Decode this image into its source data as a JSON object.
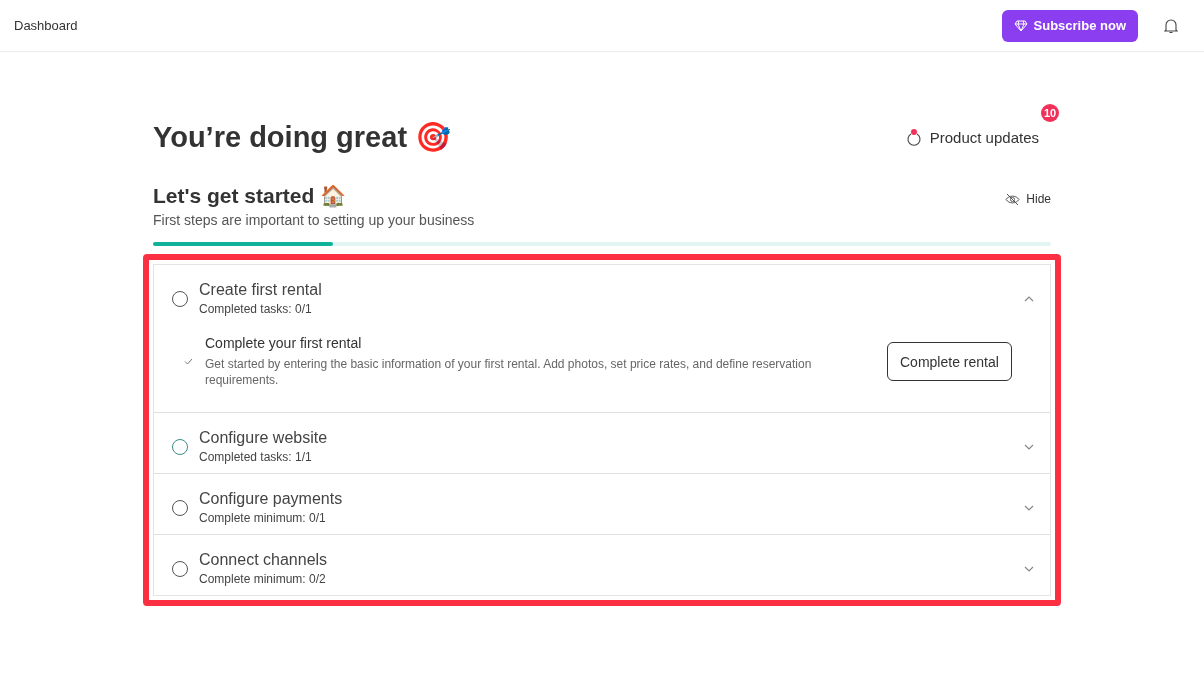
{
  "header": {
    "title": "Dashboard",
    "subscribe_button": "Subscribe now"
  },
  "heading": "You’re doing great 🎯",
  "product_updates": {
    "label": "Product updates",
    "badge": "10"
  },
  "section": {
    "title": "Let's get started 🏠",
    "subtitle": "First steps are important to setting up your business",
    "hide_label": "Hide",
    "level": 0.2
  },
  "steps": [
    {
      "title": "Create first rental",
      "status": "Completed tasks: 0/1",
      "completed": false,
      "expanded": true,
      "tasks": [
        {
          "title": "Complete your first rental",
          "description": "Get started by entering the basic information of your first rental. Add photos, set price rates, and define reservation requirements.",
          "button": "Complete rental"
        }
      ]
    },
    {
      "title": "Configure website",
      "status": "Completed tasks: 1/1",
      "completed": true,
      "expanded": false
    },
    {
      "title": "Configure payments",
      "status": "Complete minimum: 0/1",
      "completed": false,
      "expanded": false
    },
    {
      "title": "Connect channels",
      "status": "Complete minimum: 0/2",
      "completed": false,
      "expanded": false
    }
  ]
}
